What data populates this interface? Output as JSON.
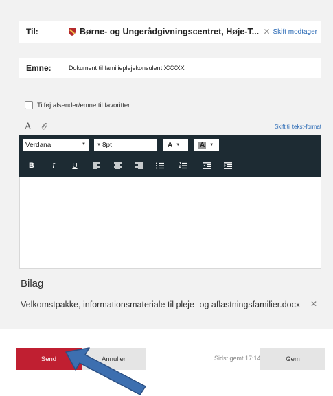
{
  "compose": {
    "to_label": "Til:",
    "recipient": "Børne- og Ungerådgivningscentret, Høje-T...",
    "remove_recipient_label": "Skift modtager",
    "subject_label": "Emne:",
    "subject_value": "Dokument til familieplejekonsulent XXXXX",
    "favorite_label": "Tilføj afsender/emne til favoritter",
    "switch_format_label": "Skift til tekst-format"
  },
  "toolbar": {
    "font_family": "Verdana",
    "font_size": "8pt",
    "fg_color_letter": "A",
    "bg_color_letter": "A",
    "bold": "B",
    "italic": "I",
    "underline": "U"
  },
  "attachments": {
    "title": "Bilag",
    "files": [
      "Velkomstpakke, informationsmateriale til pleje- og aflastningsfamilier.docx"
    ]
  },
  "footer": {
    "send_label": "Send",
    "cancel_label": "Annuller",
    "last_saved": "Sidst gemt 17:14",
    "save_label": "Gem"
  },
  "colors": {
    "send_button": "#c01f31",
    "toolbar_bg": "#1d2b33",
    "link": "#2a6ab5",
    "arrow": "#3d6fb0"
  },
  "icons": [
    "crest-icon",
    "close-icon",
    "font-icon",
    "paperclip-icon",
    "align-left-icon",
    "align-center-icon",
    "align-right-icon",
    "bullet-list-icon",
    "numbered-list-icon",
    "outdent-icon",
    "indent-icon",
    "arrow-pointer"
  ]
}
